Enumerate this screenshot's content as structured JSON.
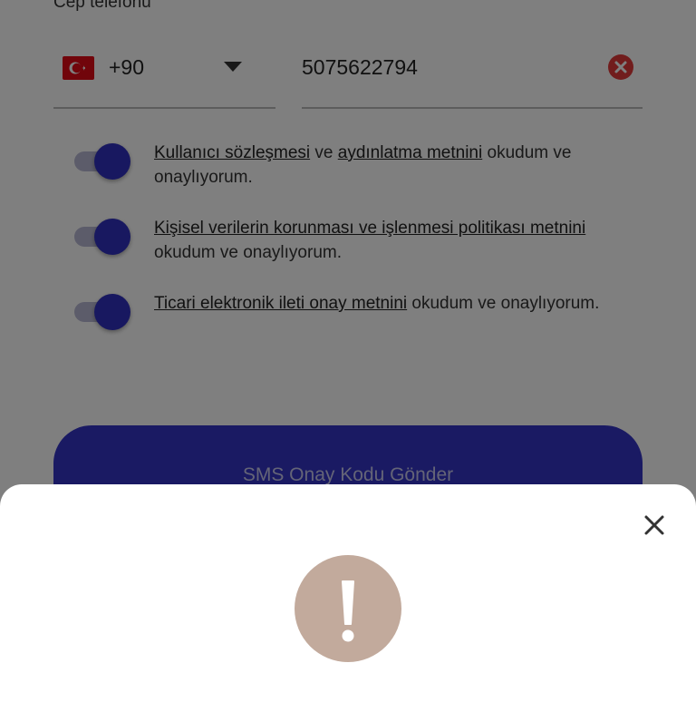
{
  "form": {
    "phone_label": "Cep telefonu",
    "country": {
      "flag_icon": "turkey-flag-icon",
      "code": "+90"
    },
    "phone_number": "5075622794",
    "consents": [
      {
        "checked": true,
        "link1": "Kullanıcı sözleşmesi",
        "mid": " ve ",
        "link2": "aydınlatma metnini",
        "rest": " okudum ve onaylıyorum."
      },
      {
        "checked": true,
        "link1": "Kişisel verilerin korunması ve işlenmesi politikası metnini",
        "mid": "",
        "link2": "",
        "rest": " okudum ve onaylıyorum."
      },
      {
        "checked": true,
        "link1": "Ticari elektronik ileti onay metnini",
        "mid": "",
        "link2": "",
        "rest": " okudum ve onaylıyorum."
      }
    ],
    "submit_label": "SMS Onay Kodu Gönder"
  },
  "sheet": {
    "close_icon": "close-icon",
    "alert_icon": "exclamation-icon"
  },
  "colors": {
    "primary": "#3434c6",
    "toggle_knob": "#3030c0",
    "clear_red": "#e23b3b",
    "alert_circle": "#c2aa9c",
    "overlay": "rgba(0,0,0,0.5)"
  }
}
